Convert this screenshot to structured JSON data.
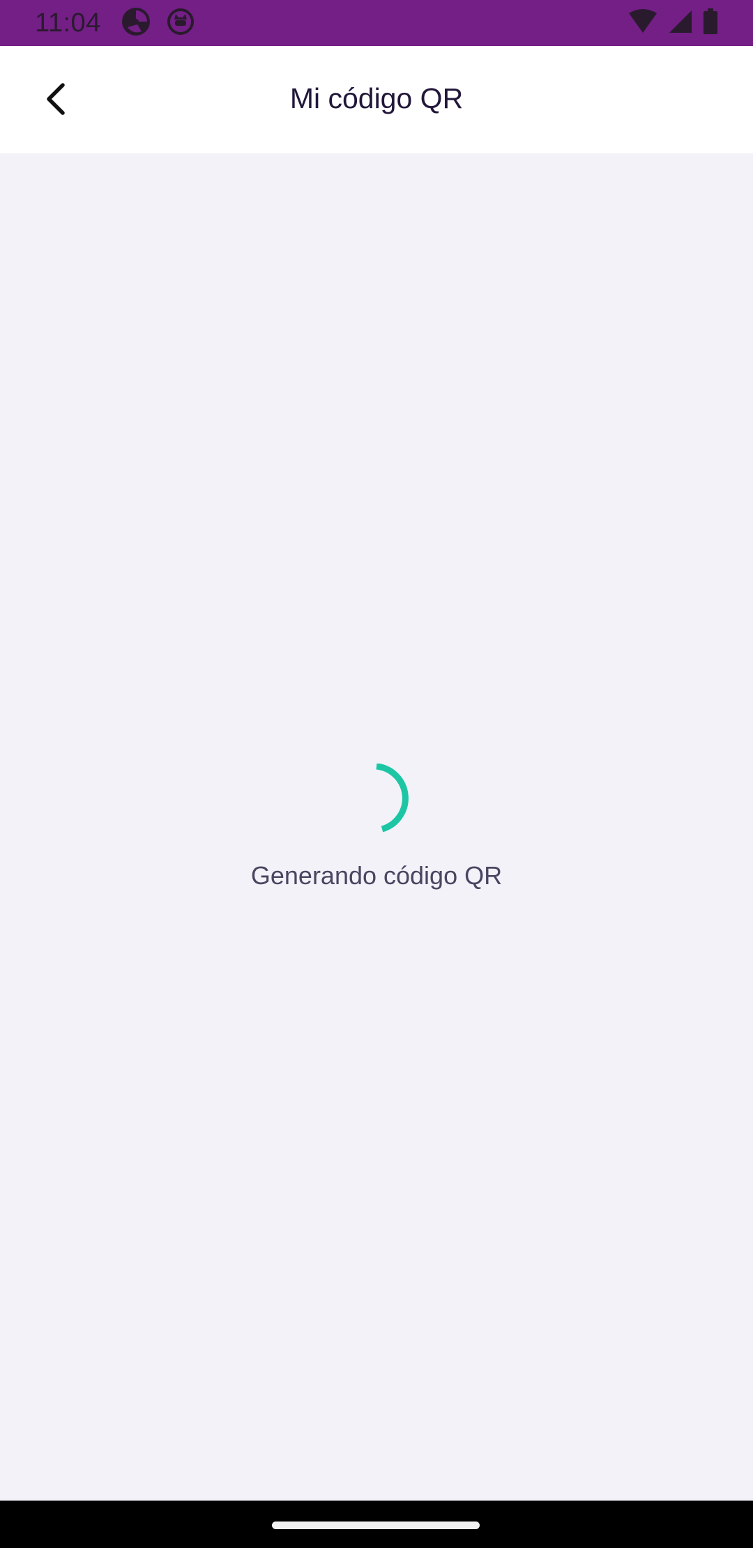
{
  "status_bar": {
    "time": "11:04",
    "icons": [
      "media-app-icon",
      "cat-app-icon",
      "wifi-icon",
      "signal-icon",
      "battery-icon"
    ],
    "background": "#731f86"
  },
  "header": {
    "title": "Mi código QR",
    "back_icon": "chevron-left-icon"
  },
  "main": {
    "loading_text": "Generando código QR",
    "spinner_color": "#1cc6a5"
  }
}
